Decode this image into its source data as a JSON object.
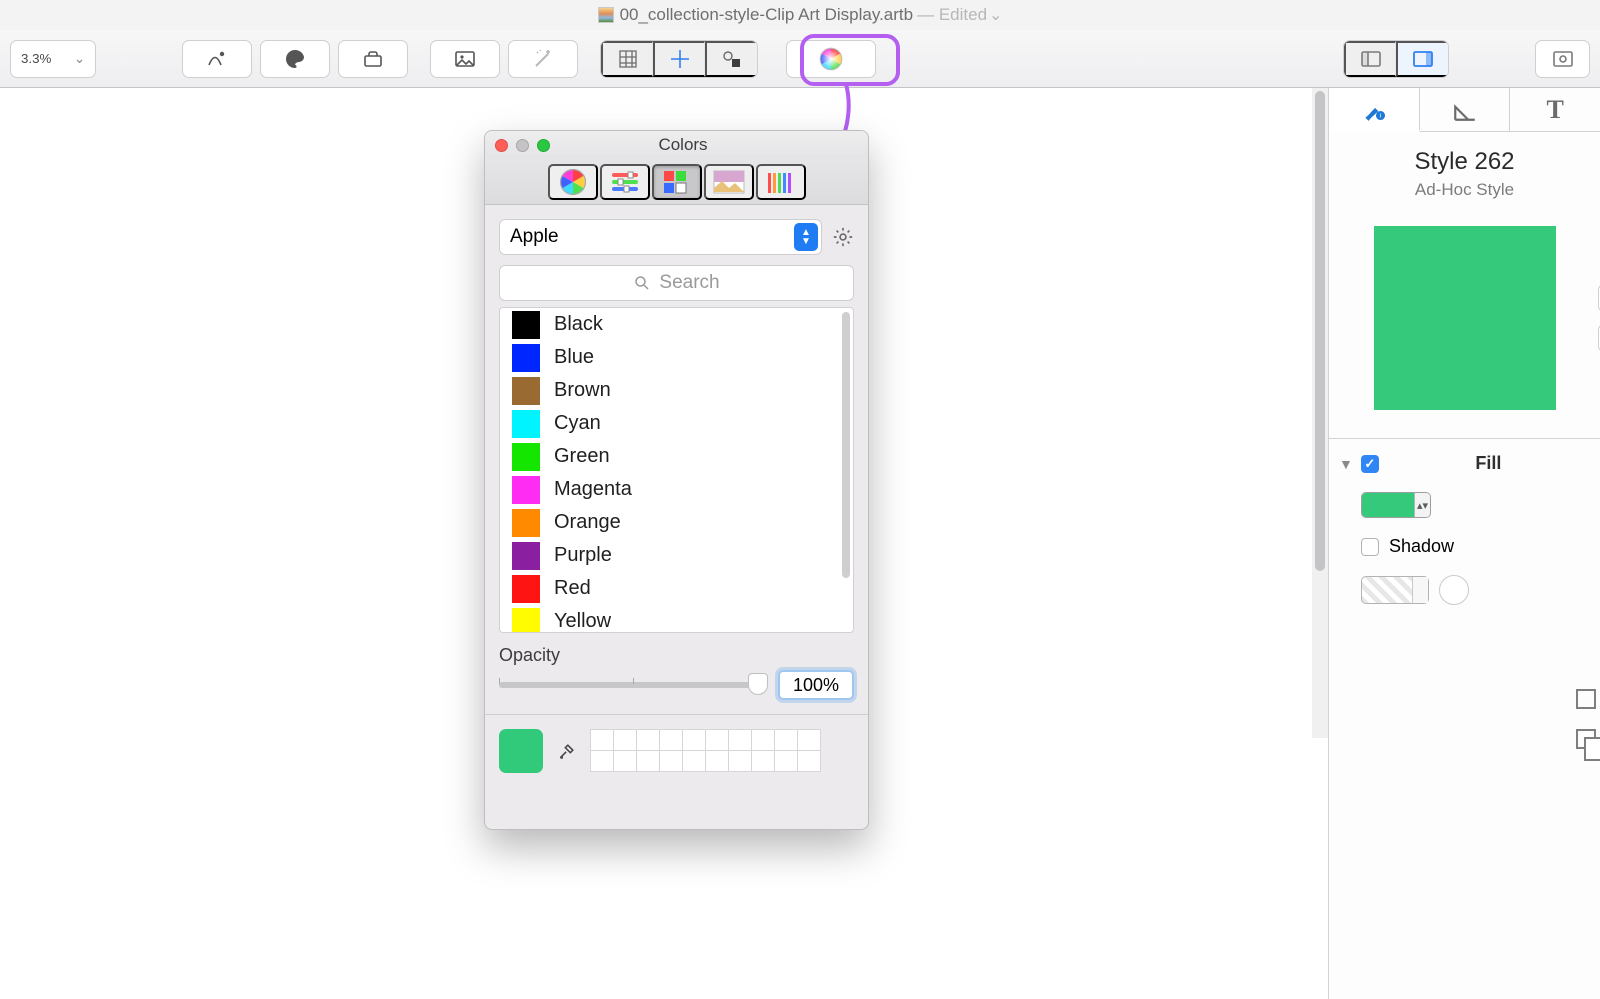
{
  "title": {
    "filename": "00_collection-style-Clip Art Display.artb",
    "status": "— Edited"
  },
  "toolbar": {
    "zoom": "3.3%"
  },
  "colors_window": {
    "title": "Colors",
    "palette_selected": "Apple",
    "search_placeholder": "Search",
    "opacity_label": "Opacity",
    "opacity_value": "100%",
    "colors": [
      {
        "name": "Black",
        "hex": "#000000"
      },
      {
        "name": "Blue",
        "hex": "#0026ff"
      },
      {
        "name": "Brown",
        "hex": "#9a6a33"
      },
      {
        "name": "Cyan",
        "hex": "#00f4ff"
      },
      {
        "name": "Green",
        "hex": "#14e600"
      },
      {
        "name": "Magenta",
        "hex": "#ff2cf3"
      },
      {
        "name": "Orange",
        "hex": "#ff8a00"
      },
      {
        "name": "Purple",
        "hex": "#8a1fa0"
      },
      {
        "name": "Red",
        "hex": "#ff1414"
      },
      {
        "name": "Yellow",
        "hex": "#fffb00"
      }
    ],
    "current_color": "#31c97a"
  },
  "inspector": {
    "style_name": "Style 262",
    "style_sub": "Ad-Hoc Style",
    "swatch_color": "#35c97b",
    "fill_label": "Fill",
    "fill_checked": true,
    "shadow_label": "Shadow",
    "shadow_checked": false
  }
}
